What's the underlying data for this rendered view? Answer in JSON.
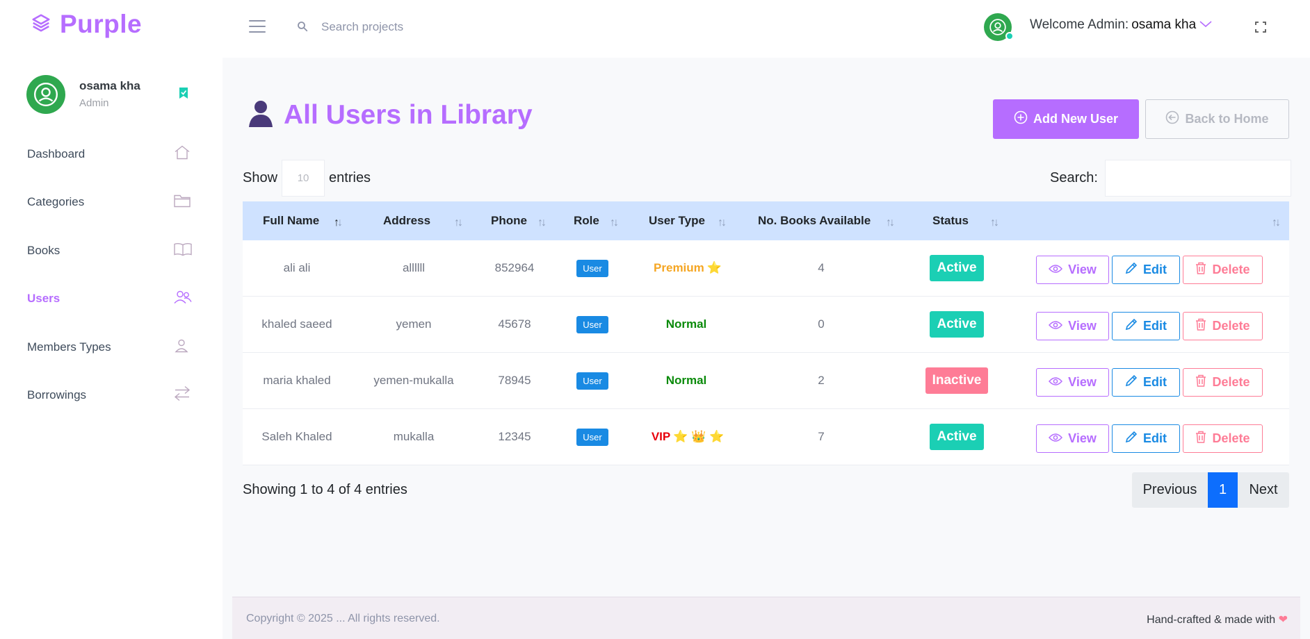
{
  "app": {
    "brand": "Purple"
  },
  "topbar": {
    "search_placeholder": "Search projects",
    "welcome_prefix": "Welcome Admin:",
    "welcome_user": "osama kha"
  },
  "sidebar": {
    "profile": {
      "name": "osama kha",
      "role": "Admin"
    },
    "items": [
      {
        "label": "Dashboard",
        "icon": "home-icon"
      },
      {
        "label": "Categories",
        "icon": "folder-icon"
      },
      {
        "label": "Books",
        "icon": "book-icon"
      },
      {
        "label": "Users",
        "icon": "users-icon",
        "active": true
      },
      {
        "label": "Members Types",
        "icon": "user-icon"
      },
      {
        "label": "Borrowings",
        "icon": "swap-icon"
      }
    ]
  },
  "page": {
    "title": "All Users in Library",
    "add_button": "Add New User",
    "back_button": "Back to Home"
  },
  "table_controls": {
    "show_label": "Show",
    "entries_value": "10",
    "entries_label": "entries",
    "search_label": "Search:"
  },
  "table": {
    "columns": [
      "Full Name",
      "Address",
      "Phone",
      "Role",
      "User Type",
      "No. Books Available",
      "Status"
    ],
    "rows": [
      {
        "name": "ali ali",
        "address": "allllll",
        "phone": "852964",
        "role": "User",
        "user_type": "Premium",
        "user_type_icons": "⭐",
        "user_type_color": "#f5a623",
        "books": "4",
        "status": "Active",
        "status_color": "#1bcfb4"
      },
      {
        "name": "khaled saeed",
        "address": "yemen",
        "phone": "45678",
        "role": "User",
        "user_type": "Normal",
        "user_type_icons": "",
        "user_type_color": "#0a8a0a",
        "books": "0",
        "status": "Active",
        "status_color": "#1bcfb4"
      },
      {
        "name": "maria khaled",
        "address": "yemen-mukalla",
        "phone": "78945",
        "role": "User",
        "user_type": "Normal",
        "user_type_icons": "",
        "user_type_color": "#0a8a0a",
        "books": "2",
        "status": "Inactive",
        "status_color": "#fe7c96"
      },
      {
        "name": "Saleh Khaled",
        "address": "mukalla",
        "phone": "12345",
        "role": "User",
        "user_type": "VIP",
        "user_type_icons": "⭐ 👑 ⭐",
        "user_type_color": "#e8000b",
        "books": "7",
        "status": "Active",
        "status_color": "#1bcfb4"
      }
    ],
    "actions": {
      "view": "View",
      "edit": "Edit",
      "delete": "Delete"
    }
  },
  "pagination": {
    "info": "Showing 1 to 4 of 4 entries",
    "previous": "Previous",
    "current": "1",
    "next": "Next"
  },
  "footer": {
    "copyright": "Copyright © 2025 ... All rights reserved.",
    "handcrafted": "Hand-crafted & made with"
  },
  "colors": {
    "accent": "#b66dff",
    "info": "#198ae3",
    "success": "#1bcfb4",
    "danger": "#fe7c96"
  }
}
